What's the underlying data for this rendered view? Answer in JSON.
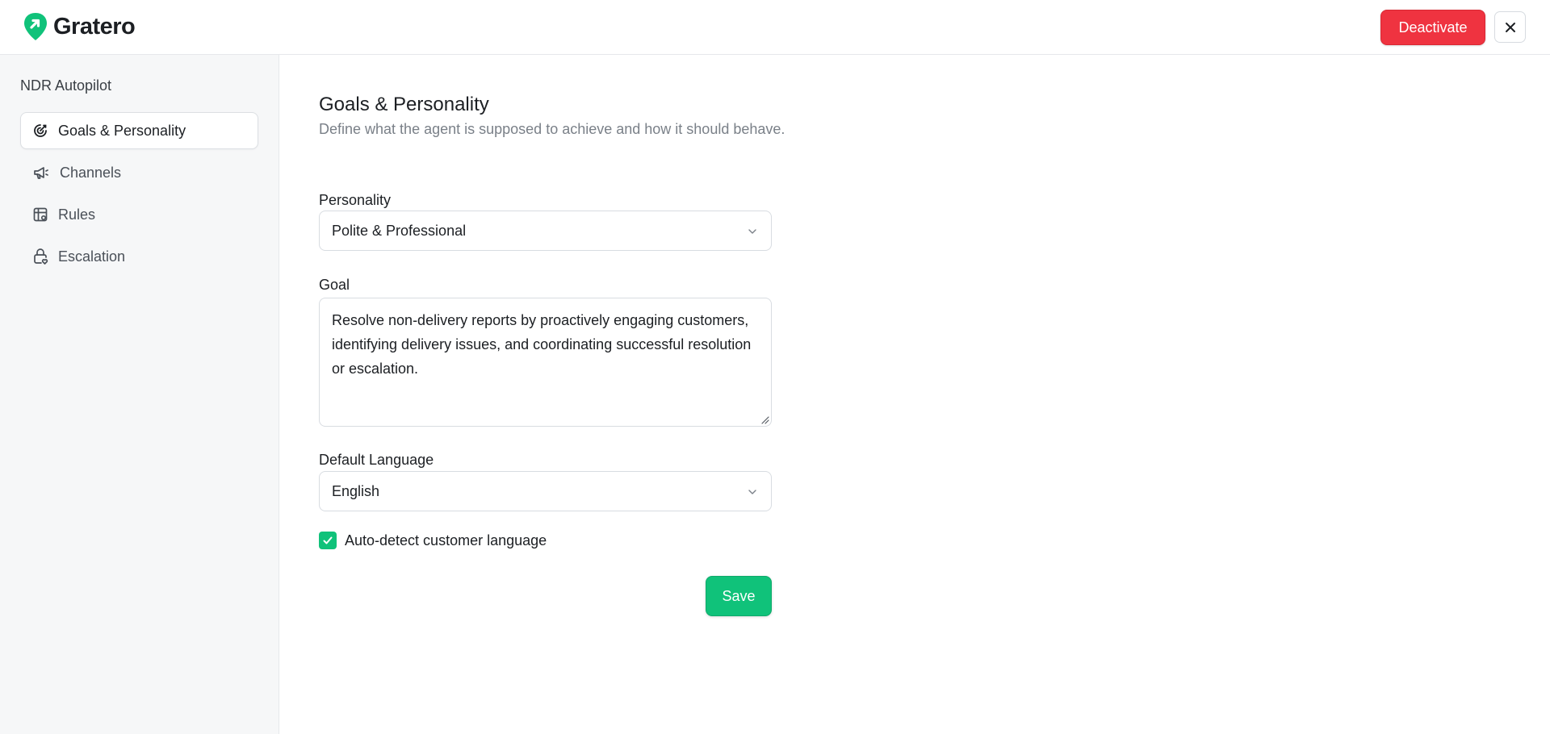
{
  "app": {
    "brand": "Gratero",
    "brand_color": "#10c27a",
    "deactivate_label": "Deactivate",
    "deactivate_color": "#ef3340",
    "close_icon": "close-icon"
  },
  "sidebar": {
    "title": "NDR Autopilot",
    "items": [
      {
        "label": "Goals & Personality",
        "icon": "target-icon",
        "active": true
      },
      {
        "label": "Channels",
        "icon": "megaphone-icon",
        "active": false
      },
      {
        "label": "Rules",
        "icon": "rules-grid-icon",
        "active": false
      },
      {
        "label": "Escalation",
        "icon": "lock-icon",
        "active": false
      }
    ]
  },
  "main": {
    "title": "Goals & Personality",
    "subtitle": "Define what the agent is supposed to achieve and how it should behave.",
    "personality": {
      "label": "Personality",
      "value": "Polite & Professional"
    },
    "goal": {
      "label": "Goal",
      "value": "Resolve non-delivery reports by proactively engaging customers, identifying delivery issues, and coordinating successful resolution or escalation."
    },
    "language": {
      "label": "Default Language",
      "value": "English"
    },
    "auto_detect": {
      "label": "Auto-detect customer language",
      "checked": true
    },
    "save_label": "Save"
  }
}
